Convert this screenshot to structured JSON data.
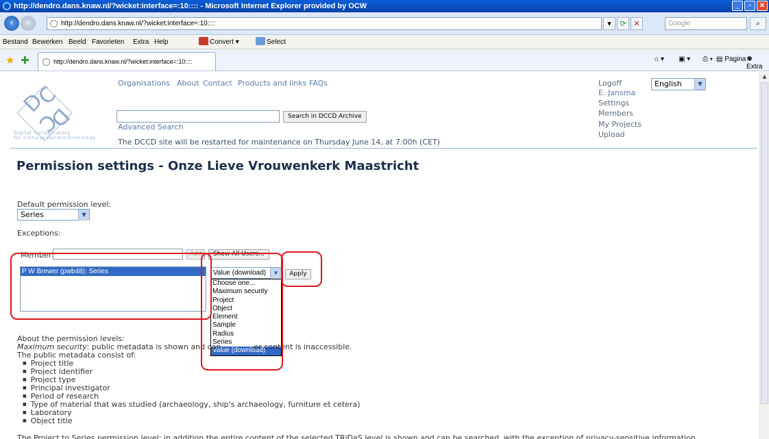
{
  "window": {
    "title": "http://dendro.dans.knaw.nl/?wicket:interface=:10:::: - Microsoft Internet Explorer provided by OCW",
    "address": "http://dendro.dans.knaw.nl/?wicket:interface=:10::::",
    "search_placeholder": "Google"
  },
  "menu": {
    "items": [
      "Bestand",
      "Bewerken",
      "Beeld",
      "Favorieten",
      "Extra",
      "Help"
    ],
    "convert": "Convert",
    "select": "Select"
  },
  "tab": {
    "label": "http://dendro.dans.knaw.nl/?wicket:interface=:10::::"
  },
  "commandbar": {
    "page": "Pagina",
    "extra": "Extra"
  },
  "site": {
    "logo_caption_1": "Digital        Collaboratory",
    "logo_caption_2": "for Cultural Dendrochronology",
    "nav": [
      "Organisations",
      "About",
      "Contact",
      "Products and links",
      "FAQs"
    ],
    "search_button": "Search in DCCD Archive",
    "advanced_search": "Advanced Search",
    "maintenance": "The DCCD site will be restarted for maintenance on Thursday June 14, at 7:00h (CET)",
    "user_menu": [
      "Logoff",
      "E. Jansma",
      "Settings",
      "Members",
      "My Projects",
      "Upload"
    ],
    "language": "English"
  },
  "page": {
    "title": "Permission settings - Onze Lieve Vrouwenkerk Maastricht",
    "default_label": "Default permission level:",
    "default_value": "Series",
    "exceptions_label": "Exceptions:",
    "member_label": "Member:",
    "add_button": "Add",
    "show_all_button": "Show All Users...",
    "exceptions": [
      "P W Brewer (pwb48): Series"
    ],
    "permission_selected": "Value (download)",
    "permission_options": [
      "Choose one...",
      "Maximum security",
      "Project",
      "Object",
      "Element",
      "Sample",
      "Radius",
      "Series",
      "Value (download)"
    ],
    "apply_button": "Apply",
    "about_heading": "About the permission levels:",
    "about_max_label": "Maximum security",
    "about_max_text_a": ": public metadata is shown and can",
    "about_max_text_b": "er content is inaccessible.",
    "public_metadata_intro": "The public metadata consist of:",
    "public_metadata": [
      "Project title",
      "Project identifier",
      "Project type",
      "Principal investigator",
      "Period of research",
      "Type of material that was studied (archaeology, ship's archaeology, furniture et cetera)",
      "Laboratory",
      "Object title"
    ],
    "bottom_text": "The Project to Series permission level: in addition the entire content of the selected TRiDaS level is shown and can be searched, with the exception of privacy-sensitive information."
  },
  "colors": {
    "highlight": "#316ac5",
    "annotation": "#e0161b",
    "link": "#5a7aa8"
  }
}
